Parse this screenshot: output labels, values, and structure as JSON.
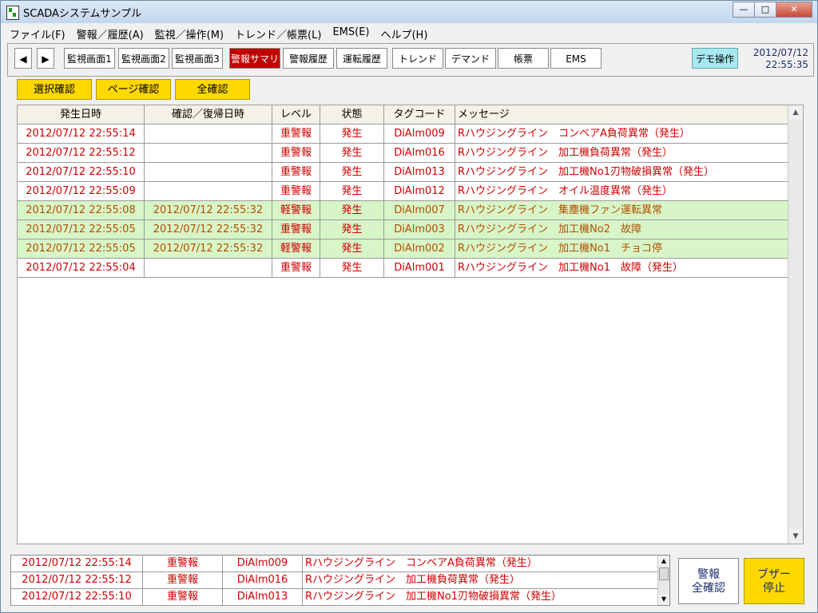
{
  "window": {
    "title": "SCADAシステムサンプル",
    "minimize": "—",
    "maximize": "□",
    "close": "✕"
  },
  "menu": [
    "ファイル(F)",
    "警報／履歴(A)",
    "監視／操作(M)",
    "トレンド／帳票(L)",
    "EMS(E)",
    "ヘルプ(H)"
  ],
  "toolbar": {
    "back": "◀",
    "forward": "▶",
    "buttons": [
      "監視画面1",
      "監視画面2",
      "監視画面3",
      "警報サマリ",
      "警報履歴",
      "運転履歴",
      "トレンド",
      "デマンド",
      "帳票",
      "EMS"
    ],
    "active": "警報サマリ",
    "demo": "デモ操作",
    "date": "2012/07/12",
    "time": "22:55:35"
  },
  "actions": [
    "選択確認",
    "ページ確認",
    "全確認"
  ],
  "grid": {
    "headers": [
      "発生日時",
      "確認／復帰日時",
      "レベル",
      "状態",
      "タグコード",
      "メッセージ"
    ],
    "rows": [
      {
        "occurred": "2012/07/12 22:55:14",
        "confirmed": "",
        "level": "重警報",
        "state": "発生",
        "tag": "DiAlm009",
        "message": "Rハウジングライン　コンベアA負荷異常（発生）",
        "acked": false
      },
      {
        "occurred": "2012/07/12 22:55:12",
        "confirmed": "",
        "level": "重警報",
        "state": "発生",
        "tag": "DiAlm016",
        "message": "Rハウジングライン　加工機負荷異常（発生）",
        "acked": false
      },
      {
        "occurred": "2012/07/12 22:55:10",
        "confirmed": "",
        "level": "重警報",
        "state": "発生",
        "tag": "DiAlm013",
        "message": "Rハウジングライン　加工機No1刃物破損異常（発生）",
        "acked": false
      },
      {
        "occurred": "2012/07/12 22:55:09",
        "confirmed": "",
        "level": "重警報",
        "state": "発生",
        "tag": "DiAlm012",
        "message": "Rハウジングライン　オイル温度異常（発生）",
        "acked": false
      },
      {
        "occurred": "2012/07/12 22:55:08",
        "confirmed": "2012/07/12 22:55:32",
        "level": "軽警報",
        "state": "発生",
        "tag": "DiAlm007",
        "message": "Rハウジングライン　集塵機ファン運転異常",
        "acked": true
      },
      {
        "occurred": "2012/07/12 22:55:05",
        "confirmed": "2012/07/12 22:55:32",
        "level": "重警報",
        "state": "発生",
        "tag": "DiAlm003",
        "message": "Rハウジングライン　加工機No2　故障",
        "acked": true
      },
      {
        "occurred": "2012/07/12 22:55:05",
        "confirmed": "2012/07/12 22:55:32",
        "level": "軽警報",
        "state": "発生",
        "tag": "DiAlm002",
        "message": "Rハウジングライン　加工機No1　チョコ停",
        "acked": true
      },
      {
        "occurred": "2012/07/12 22:55:04",
        "confirmed": "",
        "level": "重警報",
        "state": "発生",
        "tag": "DiAlm001",
        "message": "Rハウジングライン　加工機No1　故障（発生）",
        "acked": false
      }
    ]
  },
  "bottom": {
    "rows": [
      {
        "occurred": "2012/07/12 22:55:14",
        "level": "重警報",
        "tag": "DiAlm009",
        "message": "Rハウジングライン　コンベアA負荷異常（発生）"
      },
      {
        "occurred": "2012/07/12 22:55:12",
        "level": "重警報",
        "tag": "DiAlm016",
        "message": "Rハウジングライン　加工機負荷異常（発生）"
      },
      {
        "occurred": "2012/07/12 22:55:10",
        "level": "重警報",
        "tag": "DiAlm013",
        "message": "Rハウジングライン　加工機No1刃物破損異常（発生）"
      }
    ],
    "ack_all_line1": "警報",
    "ack_all_line2": "全確認",
    "buzzer_line1": "ブザー",
    "buzzer_line2": "停止"
  },
  "colors": {
    "alarm_red": "#d00000",
    "ack_bg": "#d8f5c8",
    "action_yellow": "#ffd800",
    "active_tab": "#c00000",
    "demo_cyan": "#a8e8f0"
  }
}
